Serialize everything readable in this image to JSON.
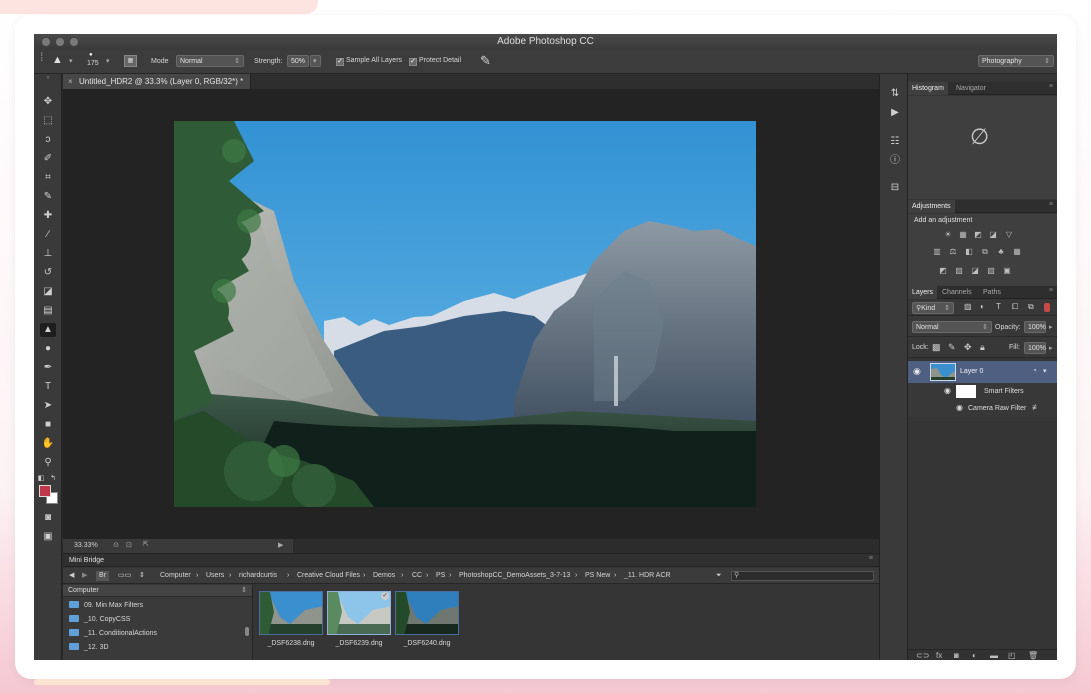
{
  "app": {
    "title": "Adobe Photoshop CC"
  },
  "options_bar": {
    "brush_size": "175",
    "mode_label": "Mode",
    "mode_value": "Normal",
    "strength_label": "Strength:",
    "strength_value": "50%",
    "sample_all_layers": "Sample All Layers",
    "protect_detail": "Protect Detail",
    "workspace": "Photography"
  },
  "document": {
    "tab_title": "Untitled_HDR2 @ 33.3% (Layer 0, RGB/32*) *",
    "zoom": "33.33%"
  },
  "panels": {
    "histogram_tab": "Histogram",
    "navigator_tab": "Navigator",
    "adjustments_tab": "Adjustments",
    "add_adjustment": "Add an adjustment",
    "layers_tab": "Layers",
    "channels_tab": "Channels",
    "paths_tab": "Paths",
    "kind_label": "Kind",
    "blend_mode": "Normal",
    "opacity_label": "Opacity:",
    "opacity_value": "100%",
    "lock_label": "Lock:",
    "fill_label": "Fill:",
    "fill_value": "100%",
    "layer_name": "Layer 0",
    "smart_filters": "Smart Filters",
    "camera_raw_filter": "Camera Raw Filter"
  },
  "mini_bridge": {
    "title": "Mini Bridge",
    "location": "Computer",
    "breadcrumbs": [
      "Computer",
      "Users",
      "richardcurtis",
      "Creative Cloud Files",
      "Demos",
      "CC",
      "PS",
      "PhotoshopCC_DemoAssets_3-7-13",
      "PS New",
      "_11. HDR ACR"
    ],
    "folders": [
      "09. Min Max Filters",
      "_10. CopyCSS",
      "_11. ConditionalActions",
      "_12. 3D"
    ],
    "thumbnails": [
      "_DSF6238.dng",
      "_DSF6239.dng",
      "_DSF6240.dng"
    ]
  },
  "colors": {
    "foreground": "#c0394a",
    "background": "#ffffff",
    "selection": "#4f5f82",
    "sky": "#3f9ad6"
  }
}
